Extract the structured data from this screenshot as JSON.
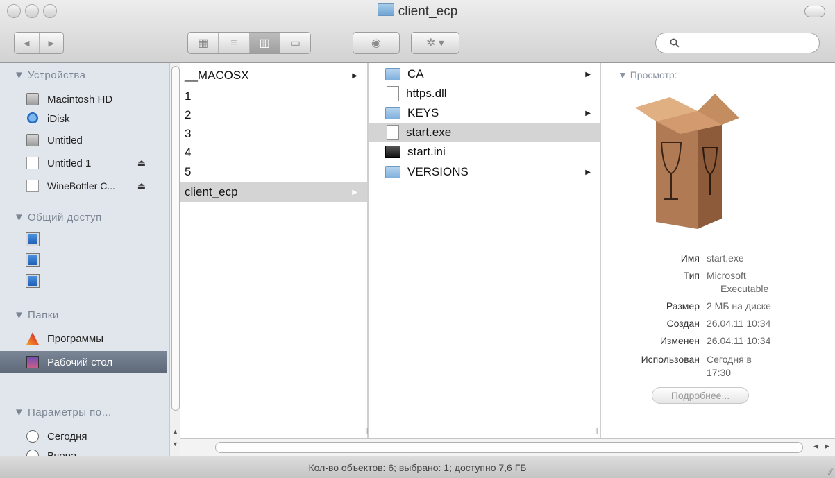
{
  "window": {
    "title": "client_ecp"
  },
  "toolbar": {
    "back_label": "◀",
    "forward_label": "▶",
    "view_icons_label": "▦",
    "view_list_label": "≡",
    "view_columns_label": "▥",
    "view_coverflow_label": "▭",
    "quicklook_label": "◉",
    "action_label": "✲ ▾",
    "search_placeholder": "",
    "search_icon": "search-icon"
  },
  "sidebar": {
    "devices_header": "▼ Устройства",
    "devices": [
      {
        "label": "Macintosh HD",
        "icon": "hard-drive-icon"
      },
      {
        "label": "iDisk",
        "icon": "idisk-icon"
      },
      {
        "label": "Untitled",
        "icon": "disk-icon"
      },
      {
        "label": "Untitled 1",
        "icon": "document-disk-icon",
        "eject": "⏏"
      },
      {
        "label": "WineBottler C...",
        "icon": "document-disk-icon",
        "eject": "⏏"
      }
    ],
    "shared_header": "▼ Общий доступ",
    "shared_count": 3,
    "places_header": "▼ Папки",
    "places": [
      {
        "label": "Программы",
        "icon": "applications-icon"
      },
      {
        "label": "Рабочий стол",
        "icon": "desktop-icon",
        "selected": true
      }
    ],
    "search_header": "▼ Параметры по...",
    "search_items": [
      {
        "label": "Сегодня",
        "icon": "clock-icon"
      },
      {
        "label": "Вчера",
        "icon": "clock-icon"
      }
    ]
  },
  "column1": {
    "items": [
      {
        "label": "__MACOSX",
        "has_children": true
      },
      {
        "label": "1"
      },
      {
        "label": "2"
      },
      {
        "label": "3"
      },
      {
        "label": "4"
      },
      {
        "label": "5"
      },
      {
        "label": "client_ecp",
        "has_children": true,
        "selected": true
      }
    ]
  },
  "column2": {
    "items": [
      {
        "label": "CA",
        "type": "folder",
        "has_children": true
      },
      {
        "label": "https.dll",
        "type": "file"
      },
      {
        "label": "KEYS",
        "type": "folder",
        "has_children": true
      },
      {
        "label": "start.exe",
        "type": "file",
        "selected": true
      },
      {
        "label": "start.ini",
        "type": "black-file"
      },
      {
        "label": "VERSIONS",
        "type": "folder",
        "has_children": true
      }
    ]
  },
  "preview": {
    "header": "▼ Просмотр:",
    "name_key": "Имя",
    "name_val": "start.exe",
    "type_key": "Тип",
    "type_val": "Microsoft",
    "type_val2": "Executable",
    "size_key": "Размер",
    "size_val": "2 МБ на диске",
    "created_key": "Создан",
    "created_val": "26.04.11 10:34",
    "modified_key": "Изменен",
    "modified_val": "26.04.11 10:34",
    "used_key": "Использован",
    "used_val": "Сегодня в",
    "used_val2": "17:30",
    "more_button": "Подробнее..."
  },
  "statusbar": {
    "text": "Кол-во объектов: 6; выбрано: 1; доступно 7,6 ГБ"
  },
  "colors": {
    "selected_sidebar": "#5d6878",
    "sidebar_bg": "#e1e6ec",
    "selected_row": "#d4d4d4"
  }
}
